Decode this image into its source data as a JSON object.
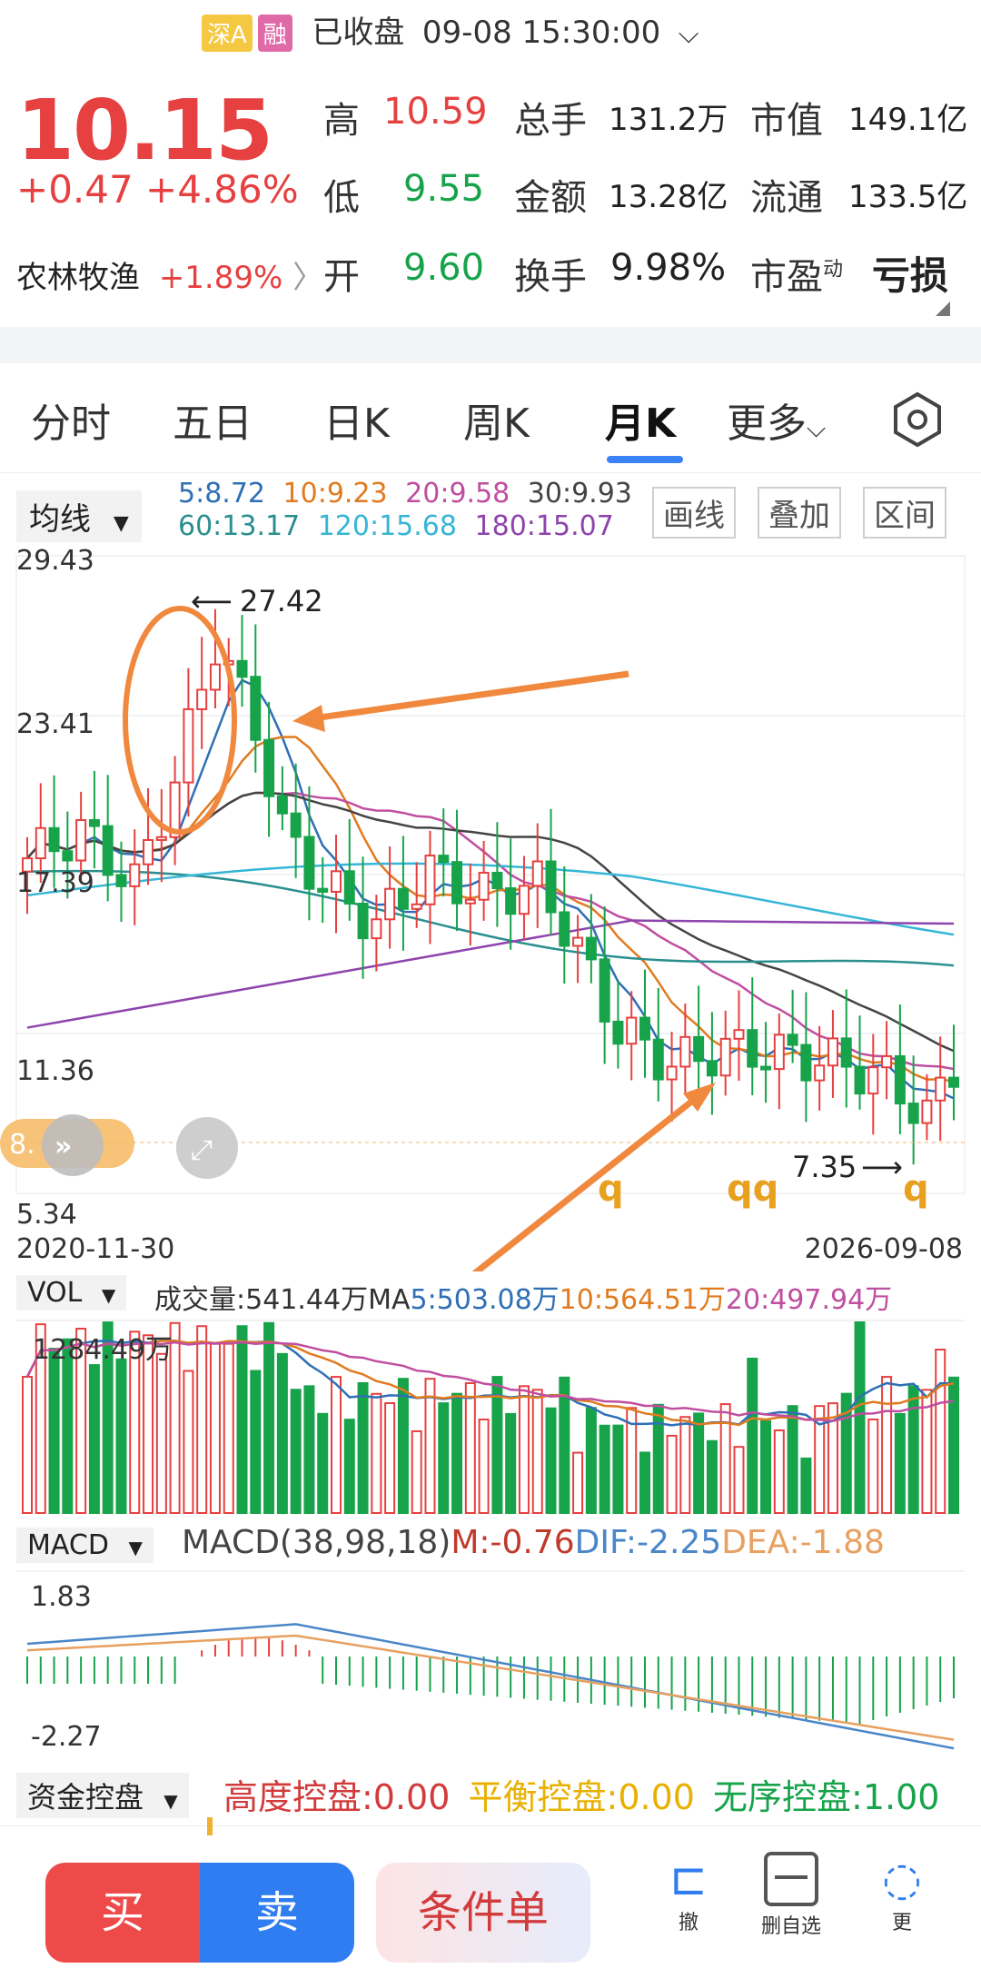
{
  "header": {
    "badge_market": "深A",
    "badge_margin": "融",
    "status": "已收盘",
    "datetime": "09-08 15:30:00"
  },
  "quote": {
    "price": "10.15",
    "change": "+0.47",
    "change_pct": "+4.86%",
    "sector_name": "农林牧渔",
    "sector_change": "+1.89%",
    "high_label": "高",
    "high": "10.59",
    "low_label": "低",
    "low": "9.55",
    "open_label": "开",
    "open": "9.60",
    "volume_label": "总手",
    "volume": "131.2万",
    "amount_label": "金额",
    "amount": "13.28亿",
    "turnover_label": "换手",
    "turnover": "9.98%",
    "mktcap_label": "市值",
    "mktcap": "149.1亿",
    "float_label": "流通",
    "float": "133.5亿",
    "pe_label": "市盈",
    "pe_sup": "动",
    "pe": "亏损"
  },
  "tabs": [
    {
      "label": "分时"
    },
    {
      "label": "五日"
    },
    {
      "label": "日K"
    },
    {
      "label": "周K"
    },
    {
      "label": "月K"
    },
    {
      "label": "更多"
    }
  ],
  "ma_legend": {
    "selector": "均线",
    "ma5": "5:8.72",
    "ma10": "10:9.23",
    "ma20": "20:9.58",
    "ma30": "30:9.93",
    "ma60": "60:13.17",
    "ma120": "120:15.68",
    "ma180": "180:15.07",
    "btn_draw": "画线",
    "btn_overlay": "叠加",
    "btn_range": "区间"
  },
  "colors": {
    "up": "#e64040",
    "down": "#17a34a",
    "ma5": "#2f6fb5",
    "ma10": "#e07b20",
    "ma20": "#c04ea0",
    "ma30": "#444444",
    "ma60": "#2a8f8f",
    "ma120": "#36b6d6",
    "ma180": "#8e44ad",
    "annotation": "#f0883e"
  },
  "kline": {
    "y_ticks": [
      "29.43",
      "23.41",
      "17.39",
      "11.36",
      "5.34"
    ],
    "x_start": "2020-11-30",
    "x_end": "2026-09-08",
    "max_label": "27.42",
    "min_label": "7.35",
    "price_tag": "8.",
    "marks": [
      "q",
      "qq",
      "q"
    ]
  },
  "volume": {
    "selector": "VOL",
    "text_volume": "成交量:541.44万",
    "text_ma_label": "MA",
    "text_ma5": "5:503.08万",
    "text_ma10": "10:564.51万",
    "text_ma20": "20:497.94万",
    "max_label": "1284.49万"
  },
  "macd": {
    "selector": "MACD",
    "params": "MACD(38,98,18)",
    "m": "M:-0.76",
    "dif": "DIF:-2.25",
    "dea": "DEA:-1.88",
    "top_label": "1.83",
    "bottom_label": "-2.27"
  },
  "fund": {
    "selector": "资金控盘",
    "high": "高度控盘:0.00",
    "balance": "平衡控盘:0.00",
    "disorder": "无序控盘:1.00"
  },
  "bottom": {
    "buy": "买",
    "sell": "卖",
    "condition": "条件单",
    "cancel": "撤",
    "custom": "删自选",
    "more": "更"
  }
}
